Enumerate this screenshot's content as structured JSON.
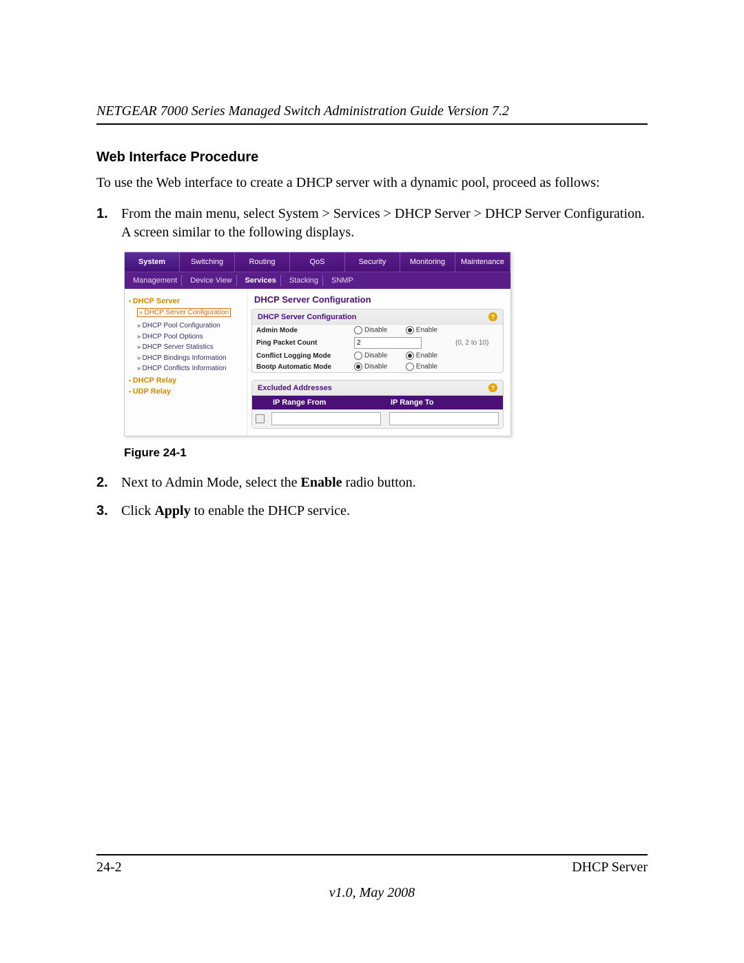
{
  "header": {
    "title": "NETGEAR 7000 Series Managed Switch Administration Guide Version 7.2"
  },
  "section": {
    "title": "Web Interface Procedure"
  },
  "intro": "To use the Web interface to create a DHCP server with a dynamic pool, proceed as follows:",
  "steps": {
    "s1_num": "1.",
    "s1_text": "From the main menu, select System > Services > DHCP Server > DHCP Server Configuration. A screen similar to the following displays.",
    "s2_num": "2.",
    "s2_pre": "Next to Admin Mode, select the ",
    "s2_bold": "Enable",
    "s2_post": " radio button.",
    "s3_num": "3.",
    "s3_pre": "Click ",
    "s3_bold": "Apply",
    "s3_post": " to enable the DHCP service."
  },
  "figure_caption": "Figure 24-1",
  "screenshot": {
    "tabs1": [
      "System",
      "Switching",
      "Routing",
      "QoS",
      "Security",
      "Monitoring",
      "Maintenance"
    ],
    "tabs2": [
      "Management",
      "Device View",
      "Services",
      "Stacking",
      "SNMP"
    ],
    "sidebar": {
      "group1_title": "DHCP Server",
      "selected": "DHCP Server Configuration",
      "items": [
        "DHCP Pool Configuration",
        "DHCP Pool Options",
        "DHCP Server Statistics",
        "DHCP Bindings Information",
        "DHCP Conflicts Information"
      ],
      "group2_title": "DHCP Relay",
      "group3_title": "UDP Relay"
    },
    "main_title": "DHCP Server Configuration",
    "panel1": {
      "title": "DHCP Server Configuration",
      "help": "?",
      "rows": {
        "admin_mode_label": "Admin Mode",
        "disable": "Disable",
        "enable": "Enable",
        "ping_label": "Ping Packet Count",
        "ping_value": "2",
        "ping_hint": "(0, 2 to 10)",
        "conflict_label": "Conflict Logging Mode",
        "bootp_label": "Bootp Automatic Mode"
      }
    },
    "panel2": {
      "title": "Excluded Addresses",
      "help": "?",
      "col1": "IP Range From",
      "col2": "IP Range To"
    }
  },
  "footer": {
    "page": "24-2",
    "section": "DHCP Server",
    "version": "v1.0, May 2008"
  }
}
